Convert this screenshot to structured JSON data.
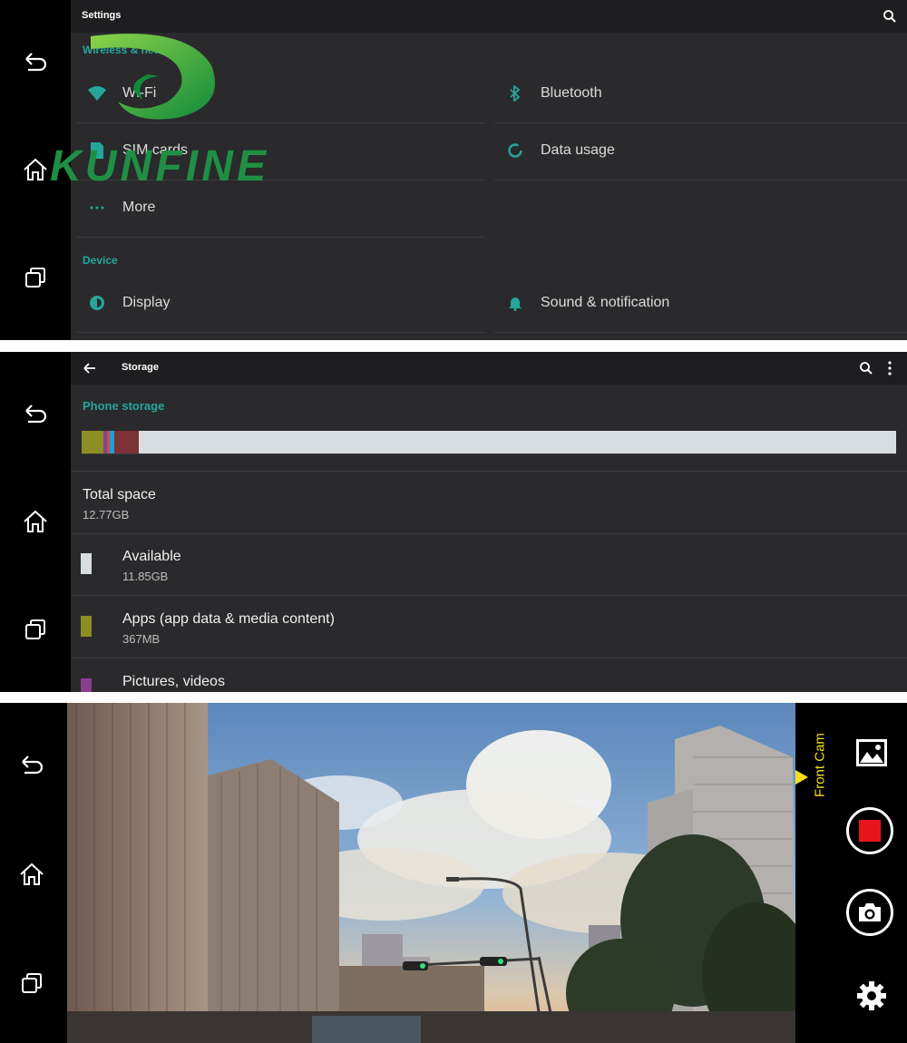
{
  "logo": {
    "text": "KUNFINE"
  },
  "settings": {
    "title": "Settings",
    "section_wireless": "Wireless & networks",
    "items_left": [
      {
        "label": "Wi-Fi",
        "icon": "wifi-icon"
      },
      {
        "label": "SIM cards",
        "icon": "sim-card-icon"
      },
      {
        "label": "More",
        "icon": "more-dots-icon"
      }
    ],
    "items_right": [
      {
        "label": "Bluetooth",
        "icon": "bluetooth-icon"
      },
      {
        "label": "Data usage",
        "icon": "data-usage-icon"
      }
    ],
    "section_device": "Device",
    "device_items": [
      {
        "label": "Display",
        "icon": "brightness-icon"
      },
      {
        "label": "Sound & notification",
        "icon": "bell-icon"
      }
    ]
  },
  "storage": {
    "title": "Storage",
    "section": "Phone storage",
    "bar_segments": [
      {
        "color": "#8d8f24",
        "fraction": 0.027
      },
      {
        "color": "#8a3f8e",
        "fraction": 0.004
      },
      {
        "color": "#c0504d",
        "fraction": 0.004
      },
      {
        "color": "#1f9fd5",
        "fraction": 0.005
      },
      {
        "color": "#7b3236",
        "fraction": 0.03
      },
      {
        "color": "#d8dde1",
        "fraction": 0.93
      }
    ],
    "total_label": "Total space",
    "total_value": "12.77GB",
    "rows": [
      {
        "title": "Available",
        "value": "11.85GB",
        "color": "#d8dde1"
      },
      {
        "title": "Apps (app data & media content)",
        "value": "367MB",
        "color": "#8d8f24"
      },
      {
        "title": "Pictures, videos",
        "value": "",
        "color": "#8a3f8e"
      }
    ]
  },
  "camera": {
    "cam_label": "Front Cam",
    "cam_label_color": "#f5e11a",
    "record_color": "#e8141c"
  },
  "colors": {
    "accent": "#26a69a",
    "nav_bg": "#000000",
    "panel_bg": "#2a2a2c"
  }
}
